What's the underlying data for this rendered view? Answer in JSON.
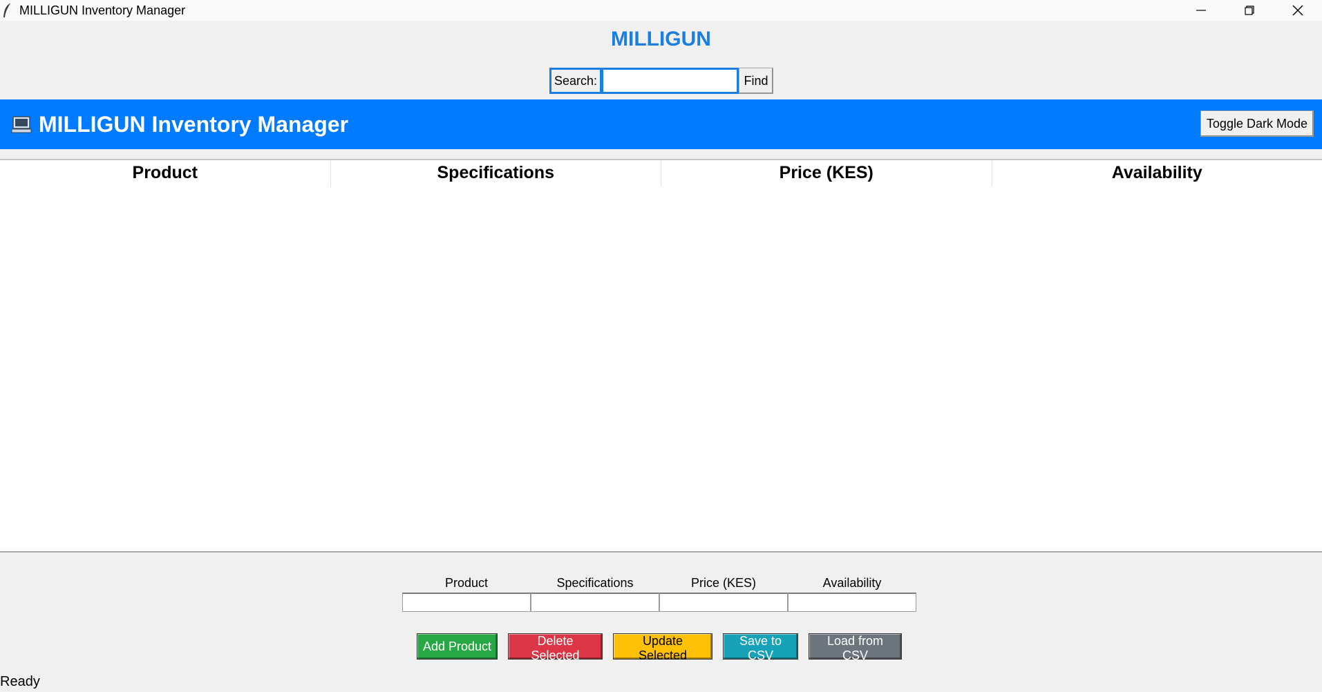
{
  "window": {
    "title": "MILLIGUN Inventory Manager"
  },
  "brand": "MILLIGUN",
  "search": {
    "label": "Search:",
    "value": "",
    "button": "Find"
  },
  "header": {
    "title": "MILLIGUN Inventory Manager",
    "toggle_dark_mode": "Toggle Dark Mode"
  },
  "table": {
    "columns": [
      "Product",
      "Specifications",
      "Price (KES)",
      "Availability"
    ],
    "rows": []
  },
  "form": {
    "fields": [
      {
        "label": "Product",
        "value": ""
      },
      {
        "label": "Specifications",
        "value": ""
      },
      {
        "label": "Price (KES)",
        "value": ""
      },
      {
        "label": "Availability",
        "value": ""
      }
    ]
  },
  "actions": {
    "add": "Add Product",
    "delete": "Delete Selected",
    "update": "Update Selected",
    "save": "Save to CSV",
    "load": "Load from CSV"
  },
  "status": "Ready",
  "colors": {
    "accent": "#007bff",
    "brand_text": "#1a7ee3",
    "add": "#28a745",
    "delete": "#dc3545",
    "update": "#ffc107",
    "save": "#17a2b8",
    "load": "#6c757d"
  },
  "icons": {
    "app": "feather-icon",
    "header": "computer-icon"
  }
}
